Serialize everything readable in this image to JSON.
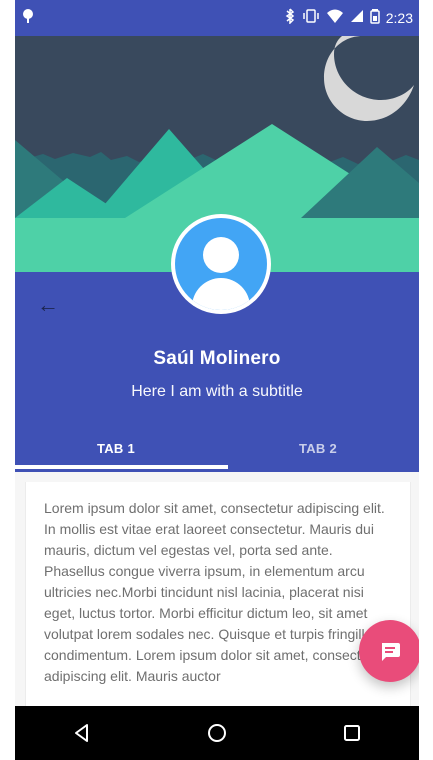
{
  "status_bar": {
    "time": "2:23",
    "icons": {
      "notification": "android-icon",
      "bluetooth": "bluetooth-icon",
      "vibration": "vibrate-icon",
      "wifi": "wifi-icon",
      "signal": "signal-icon",
      "battery": "battery-icon"
    }
  },
  "hero": {
    "illustration": "night-mountains",
    "sky_color": "#39495d",
    "mountain_colors": [
      "#2e7a7b",
      "#2fb99e",
      "#4ed1a7"
    ],
    "moon_color": "#d8d8d8"
  },
  "profile": {
    "name": "Saúl Molinero",
    "subtitle": "Here I am with a subtitle",
    "avatar_icon": "person-avatar-icon"
  },
  "navigation": {
    "back_icon": "arrow-back-icon"
  },
  "tabs": [
    {
      "label": "TAB 1"
    },
    {
      "label": "TAB 2"
    }
  ],
  "content": {
    "body": "Lorem ipsum dolor sit amet, consectetur adipiscing elit. In mollis est vitae erat laoreet consectetur. Mauris dui mauris, dictum vel egestas vel, porta sed ante. Phasellus congue viverra ipsum, in elementum arcu ultricies nec.Morbi tincidunt nisl lacinia, placerat nisi eget, luctus tortor. Morbi efficitur dictum leo, sit amet volutpat lorem sodales nec. Quisque et turpis fringilla condimentum. Lorem ipsum dolor sit amet, consectetur adipiscing elit. Mauris auctor"
  },
  "fab": {
    "icon": "message-icon",
    "color": "#e94c7a"
  },
  "system_nav": {
    "back": "triangle-back-icon",
    "home": "circle-home-icon",
    "recents": "square-recents-icon"
  },
  "theme": {
    "primary": "#3f51b5",
    "accent": "#e94c7a",
    "text_secondary": "#6f6f6f"
  }
}
